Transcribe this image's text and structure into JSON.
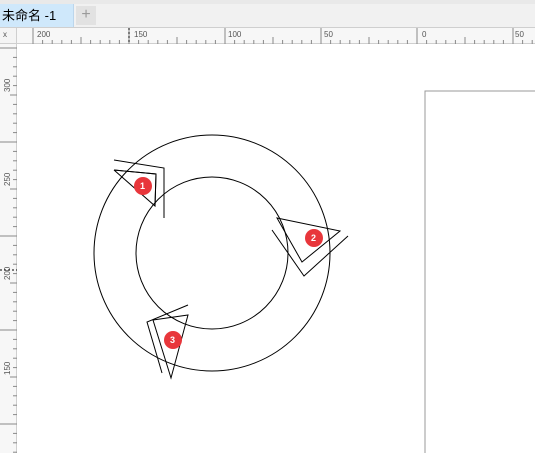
{
  "tab": {
    "title": "未命名 -1",
    "new_tab_symbol": "+"
  },
  "ruler_corner_glyph": "x",
  "ruler_top_labels": [
    "200",
    "150",
    "100",
    "50",
    "0",
    "50"
  ],
  "ruler_left_labels": [
    "300",
    "250",
    "200",
    "150"
  ],
  "badges": [
    "1",
    "2",
    "3"
  ],
  "colors": {
    "badge": "#e8363b",
    "tab_active": "#cfe8fb",
    "line": "#000000"
  }
}
